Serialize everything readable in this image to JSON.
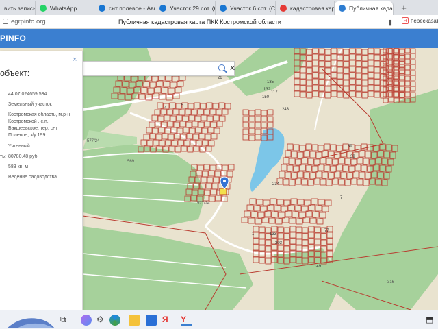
{
  "browser": {
    "tabs": [
      {
        "title": "вить запись",
        "icon_color": "#e53935"
      },
      {
        "title": "WhatsApp",
        "icon_color": "#25d366"
      },
      {
        "title": "снт полевое - Ави",
        "icon_color": "#1976d2"
      },
      {
        "title": "Участок 29 сот. (СН",
        "icon_color": "#1976d2"
      },
      {
        "title": "Участок 6 сот. (СНТ",
        "icon_color": "#1976d2"
      },
      {
        "title": "кадастровая карта",
        "icon_color": "#e53935"
      },
      {
        "title": "Публичная када",
        "icon_color": "#2e7dd1",
        "active": true
      }
    ],
    "new_tab_label": "+",
    "url": "egrpinfo.org",
    "page_title": "Публичная кадастровая карта ПКК Костромской области",
    "route_label": "пересказат"
  },
  "site": {
    "logo": "PINFO"
  },
  "search": {
    "placeholder": "",
    "value": ""
  },
  "panel": {
    "title": "объект:",
    "close": "×",
    "cad_number": "44:07:024659:534",
    "type": "Земельный участок",
    "address_l1": "Костромская область, м.р-н",
    "address_l2": "Костромской , с.п.",
    "address_l3": "Бакшеевское, тер. снт",
    "address_l4": "Полевое, з/у 199",
    "status": "Учтенный",
    "cost_label": "ть:",
    "cost": "80780.48 руб.",
    "area": "583 кв. м",
    "usage": "Ведение садоводства"
  },
  "map": {
    "labels": [
      "569",
      "577/24",
      "577/24",
      "316",
      "77",
      "26",
      "150",
      "135",
      "132",
      "4",
      "5",
      "117",
      "243",
      "234",
      "7",
      "39",
      "39",
      "1",
      "133",
      "303",
      "149"
    ],
    "colors": {
      "land": "#e9e3cf",
      "green": "#a6d19b",
      "water": "#7cc6e8",
      "parcel": "#b93b2f",
      "road": "#ffffff"
    }
  }
}
